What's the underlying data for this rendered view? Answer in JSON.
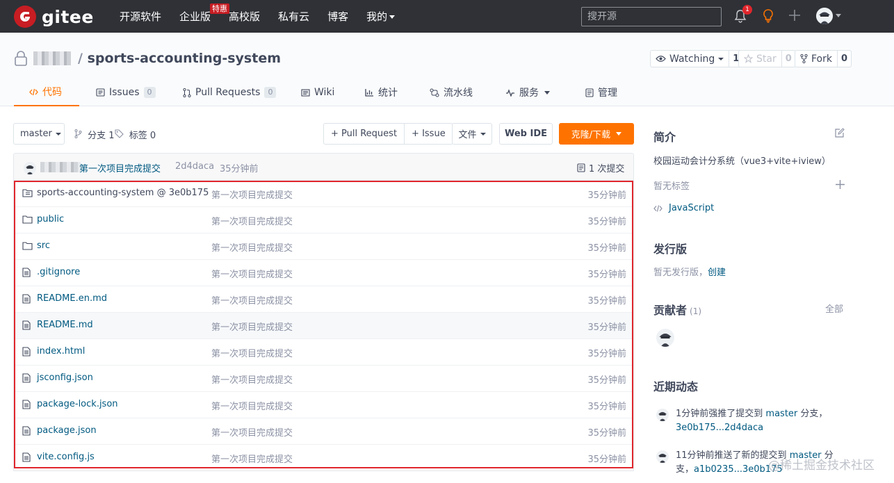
{
  "topnav": {
    "logo_text": "gitee",
    "links": [
      "开源软件",
      "企业版",
      "高校版",
      "私有云",
      "博客",
      "我的"
    ],
    "promo_badge": "特惠",
    "search_placeholder": "搜开源",
    "notification_count": "1"
  },
  "repo": {
    "name": "sports-accounting-system",
    "watching_label": "Watching",
    "watching_count": "1",
    "star_label": "Star",
    "star_count": "0",
    "fork_label": "Fork",
    "fork_count": "0"
  },
  "tabs": [
    {
      "label": "代码",
      "icon": "code-icon"
    },
    {
      "label": "Issues",
      "count": "0",
      "icon": "issues-icon"
    },
    {
      "label": "Pull Requests",
      "count": "0",
      "icon": "pull-request-icon"
    },
    {
      "label": "Wiki",
      "icon": "wiki-icon"
    },
    {
      "label": "统计",
      "icon": "stats-icon"
    },
    {
      "label": "流水线",
      "icon": "pipeline-icon"
    },
    {
      "label": "服务",
      "icon": "service-icon"
    },
    {
      "label": "管理",
      "icon": "manage-icon"
    }
  ],
  "toolbar": {
    "branch": "master",
    "branches": "分支 1",
    "tags": "标签 0",
    "pull_request": "+ Pull Request",
    "issue": "+ Issue",
    "file": "文件",
    "web_ide": "Web IDE",
    "clone": "克隆/下载"
  },
  "commit": {
    "message": "第一次项目完成提交",
    "hash": "2d4daca",
    "time": "35分钟前",
    "count": "1 次提交"
  },
  "files": [
    {
      "name": "sports-accounting-system @ 3e0b175",
      "type": "submodule",
      "message": "第一次项目完成提交",
      "time": "35分钟前"
    },
    {
      "name": "public",
      "type": "folder",
      "message": "第一次项目完成提交",
      "time": "35分钟前"
    },
    {
      "name": "src",
      "type": "folder",
      "message": "第一次项目完成提交",
      "time": "35分钟前"
    },
    {
      "name": ".gitignore",
      "type": "file",
      "message": "第一次项目完成提交",
      "time": "35分钟前"
    },
    {
      "name": "README.en.md",
      "type": "file",
      "message": "第一次项目完成提交",
      "time": "35分钟前"
    },
    {
      "name": "README.md",
      "type": "file",
      "message": "第一次项目完成提交",
      "time": "35分钟前"
    },
    {
      "name": "index.html",
      "type": "file",
      "message": "第一次项目完成提交",
      "time": "35分钟前"
    },
    {
      "name": "jsconfig.json",
      "type": "file",
      "message": "第一次项目完成提交",
      "time": "35分钟前"
    },
    {
      "name": "package-lock.json",
      "type": "file",
      "message": "第一次项目完成提交",
      "time": "35分钟前"
    },
    {
      "name": "package.json",
      "type": "file",
      "message": "第一次项目完成提交",
      "time": "35分钟前"
    },
    {
      "name": "vite.config.js",
      "type": "file",
      "message": "第一次项目完成提交",
      "time": "35分钟前"
    }
  ],
  "sidebar": {
    "intro_title": "简介",
    "intro_text": "校园运动会计分系统（vue3+vite+iview）",
    "no_tags": "暂无标签",
    "language": "JavaScript",
    "release_title": "发行版",
    "no_release": "暂无发行版，",
    "create_link": "创建",
    "contributors_title": "贡献者",
    "contributors_count": "(1)",
    "all_link": "全部",
    "activity_title": "近期动态",
    "activity1_prefix": "1分钟前强推了提交到",
    "activity1_branch": "master",
    "activity1_mid": "分支，",
    "activity1_range": "3e0b175...2d4daca",
    "activity2_prefix": "11分钟前推送了新的提交到",
    "activity2_branch": "master",
    "activity2_mid": "分支，",
    "activity2_range": "a1b0235...3e0b175"
  },
  "watermark": "@稀土掘金技术社区",
  "colors": {
    "accent": "#fe7300",
    "brand": "#c71d23",
    "link": "#005980",
    "highlight_frame": "#e0262c"
  }
}
